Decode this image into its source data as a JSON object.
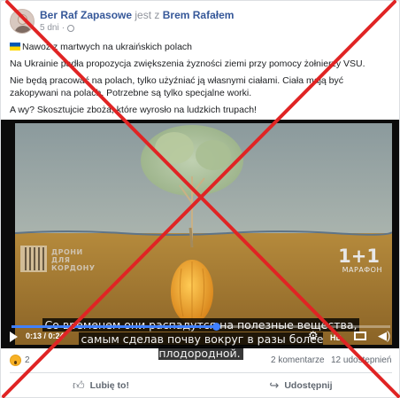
{
  "post": {
    "author": "Ber Raf Zapasowe",
    "connector": "jest z",
    "with": "Brem Rafałem",
    "time": "5 dni",
    "time_separator": "·",
    "line1": "Nawoż z martwych na ukraińskich polach",
    "line2": "Na Ukrainie padła propozycja zwiększenia żyzności ziemi przy pomocy żołnierzy VSU.",
    "line3": "Nie będą pracować na polach, tylko użyźniać ją własnymi ciałami. Ciała mają być zakopywani na polach. Potrzebne są tylko specjalne worki.",
    "line4": "A wy? Skosztujcie zboża, które wyrosło na ludzkich trupach!"
  },
  "video": {
    "overlay_left": "ДРОНИ ДЛЯ КОРДОНУ",
    "channel_logo": "1+1",
    "channel_sub": "МАРАФОН",
    "subtitle_line1": "Со временем они распадутся на полезные вещества,",
    "subtitle_line2": "самым сделав почву вокруг в разы более плодородной.",
    "time": "0:13 / 0:24",
    "progress": 0.54,
    "hd_label": "HD"
  },
  "stats": {
    "reactions": "2",
    "comments": "2 komentarze",
    "shares": "12 udostępnień"
  },
  "actions": {
    "like": "Lubię to!",
    "share": "Udostępnij"
  },
  "colors": {
    "link": "#365899",
    "cross": "#e02424",
    "progress": "#4080ff"
  }
}
